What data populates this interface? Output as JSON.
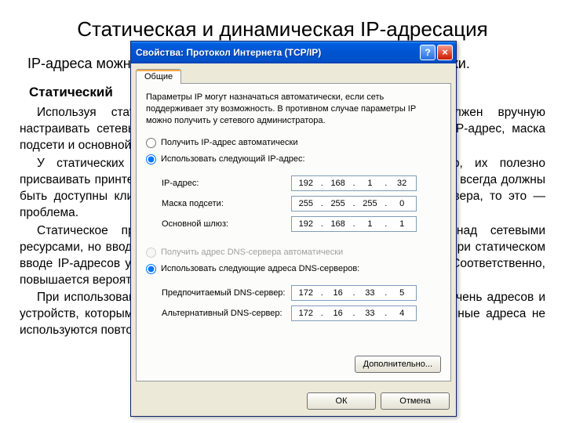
{
  "bg": {
    "title": "Статическая и динамическая IP-адресация",
    "sub": "IP-адреса можно присваивать либо статически, либо динамически.",
    "h1": "Статический",
    "p1": "Используя статическое присвоение, сетевой администратор должен вручную настраивать сетевые параметры узла. Как минимум, это должен быть IP-адрес, маска подсети и основной шлюз.",
    "p2": "У статических адресов есть некоторые преимущества. Например, их полезно присваивать принтерам, серверам и прочим сетевым устройствам, которые всегда должны быть доступны клиентам в сети. Если узлы не способны достигать сервера, то это — проблема.",
    "p3": "Статическое присвоение облегчает административный контроль над сетевыми ресурсами, но ввод этих данных на каждом узле требует много времени. При статическом вводе IP-адресов узел выявляет только встроенные ошибки в IP-адресе. Соответственно, повышается вероятность ошибки.",
    "p4": "При использовании статической IP-адресации важно вести точный перечень адресов и устройств, которым они присвоены. Помимо прочего, обычно эти постоянные адреса не используются повторно."
  },
  "dialog": {
    "title": "Свойства: Протокол Интернета (TCP/IP)",
    "tab": "Общие",
    "desc": "Параметры IP могут назначаться автоматически, если сеть поддерживает эту возможность. В противном случае параметры IP можно получить у сетевого администратора.",
    "r_auto_ip": "Получить IP-адрес автоматически",
    "r_use_ip": "Использовать следующий IP-адрес:",
    "l_ip": "IP-адрес:",
    "l_mask": "Маска подсети:",
    "l_gw": "Основной шлюз:",
    "r_auto_dns": "Получить адрес DNS-сервера автоматически",
    "r_use_dns": "Использовать следующие адреса DNS-серверов:",
    "l_dns1": "Предпочитаемый DNS-сервер:",
    "l_dns2": "Альтернативный DNS-сервер:",
    "advanced": "Дополнительно...",
    "ok": "ОК",
    "cancel": "Отмена",
    "ip": {
      "a": "192",
      "b": "168",
      "c": "1",
      "d": "32"
    },
    "mask": {
      "a": "255",
      "b": "255",
      "c": "255",
      "d": "0"
    },
    "gw": {
      "a": "192",
      "b": "168",
      "c": "1",
      "d": "1"
    },
    "dns1": {
      "a": "172",
      "b": "16",
      "c": "33",
      "d": "5"
    },
    "dns2": {
      "a": "172",
      "b": "16",
      "c": "33",
      "d": "4"
    }
  }
}
